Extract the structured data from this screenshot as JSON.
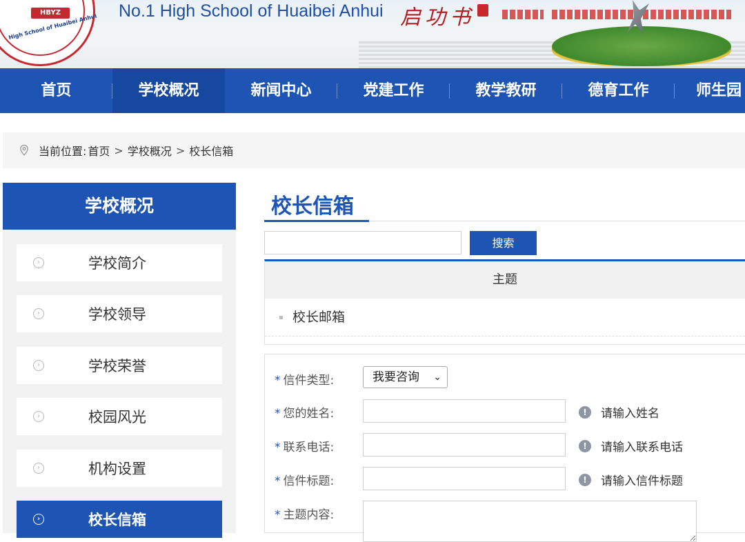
{
  "header": {
    "logo_mark": "HBYZ",
    "logo_arc_text": "High School of Huaibei Anhui",
    "school_name_en": "No.1 High School of Huaibei Anhui",
    "calligraphy": "启功书"
  },
  "nav": {
    "items": [
      {
        "label": "首页",
        "active": false
      },
      {
        "label": "学校概况",
        "active": true
      },
      {
        "label": "新闻中心",
        "active": false
      },
      {
        "label": "党建工作",
        "active": false
      },
      {
        "label": "教学教研",
        "active": false
      },
      {
        "label": "德育工作",
        "active": false
      },
      {
        "label": "师生园",
        "active": false
      }
    ]
  },
  "breadcrumb": {
    "prefix": "当前位置:",
    "items": [
      "首页",
      "学校概况",
      "校长信箱"
    ],
    "separator": ">"
  },
  "sidebar": {
    "title": "学校概况",
    "items": [
      {
        "label": "学校简介",
        "active": false
      },
      {
        "label": "学校领导",
        "active": false
      },
      {
        "label": "学校荣誉",
        "active": false
      },
      {
        "label": "校园风光",
        "active": false
      },
      {
        "label": "机构设置",
        "active": false
      },
      {
        "label": "校长信箱",
        "active": true
      }
    ]
  },
  "main": {
    "title": "校长信箱",
    "search": {
      "value": "",
      "button_label": "搜索"
    },
    "table": {
      "header": "主题",
      "rows": [
        "校长邮箱"
      ]
    },
    "form": {
      "type": {
        "label": "信件类型:",
        "value": "我要咨询"
      },
      "name": {
        "label": "您的姓名:",
        "value": "",
        "hint": "请输入姓名"
      },
      "phone": {
        "label": "联系电话:",
        "value": "",
        "hint": "请输入联系电话"
      },
      "subject": {
        "label": "信件标题:",
        "value": "",
        "hint": "请输入信件标题"
      },
      "content": {
        "label": "主题内容:",
        "value": ""
      },
      "required_mark": "*"
    }
  },
  "colors": {
    "primary": "#1e55b4",
    "primary_dark": "#1648a0",
    "brand_red": "#c8272d",
    "hint_icon": "#8f96a3"
  },
  "icons": {
    "location": "map-pin-icon",
    "side_bullet": "chevron-circle-right-icon",
    "info": "info-circle-icon",
    "dropdown": "chevron-down-icon"
  }
}
